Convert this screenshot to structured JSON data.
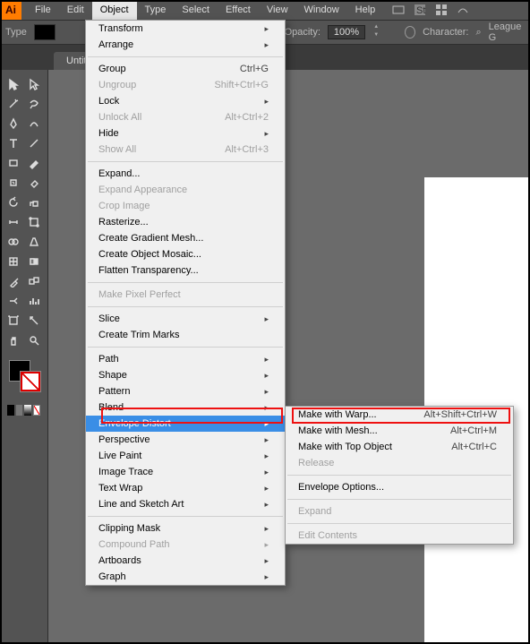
{
  "menubar": {
    "items": [
      "File",
      "Edit",
      "Object",
      "Type",
      "Select",
      "Effect",
      "View",
      "Window",
      "Help"
    ],
    "logo": "Ai"
  },
  "optionsbar": {
    "type_label": "Type",
    "opacity_label": "Opacity:",
    "opacity_value": "100%",
    "character_label": "Character:",
    "font_search": "League G"
  },
  "tab": {
    "title": "Untitl"
  },
  "tools": [
    [
      "selection",
      "direct-selection"
    ],
    [
      "magic-wand",
      "lasso"
    ],
    [
      "pen",
      "curvature"
    ],
    [
      "type",
      "line-segment"
    ],
    [
      "rectangle",
      "paintbrush"
    ],
    [
      "shaper",
      "eraser"
    ],
    [
      "rotate",
      "scale"
    ],
    [
      "width",
      "free-transform"
    ],
    [
      "shape-builder",
      "perspective"
    ],
    [
      "mesh",
      "gradient"
    ],
    [
      "eyedropper",
      "blend"
    ],
    [
      "symbol-sprayer",
      "column-graph"
    ],
    [
      "artboard",
      "slice"
    ],
    [
      "hand",
      "zoom"
    ]
  ],
  "object_menu": [
    {
      "label": "Transform",
      "sub": true
    },
    {
      "label": "Arrange",
      "sub": true
    },
    {
      "sep": true
    },
    {
      "label": "Group",
      "shortcut": "Ctrl+G"
    },
    {
      "label": "Ungroup",
      "shortcut": "Shift+Ctrl+G",
      "disabled": true
    },
    {
      "label": "Lock",
      "sub": true
    },
    {
      "label": "Unlock All",
      "shortcut": "Alt+Ctrl+2",
      "disabled": true
    },
    {
      "label": "Hide",
      "sub": true
    },
    {
      "label": "Show All",
      "shortcut": "Alt+Ctrl+3",
      "disabled": true
    },
    {
      "sep": true
    },
    {
      "label": "Expand..."
    },
    {
      "label": "Expand Appearance",
      "disabled": true
    },
    {
      "label": "Crop Image",
      "disabled": true
    },
    {
      "label": "Rasterize..."
    },
    {
      "label": "Create Gradient Mesh..."
    },
    {
      "label": "Create Object Mosaic..."
    },
    {
      "label": "Flatten Transparency..."
    },
    {
      "sep": true
    },
    {
      "label": "Make Pixel Perfect",
      "disabled": true
    },
    {
      "sep": true
    },
    {
      "label": "Slice",
      "sub": true
    },
    {
      "label": "Create Trim Marks"
    },
    {
      "sep": true
    },
    {
      "label": "Path",
      "sub": true
    },
    {
      "label": "Shape",
      "sub": true
    },
    {
      "label": "Pattern",
      "sub": true
    },
    {
      "label": "Blend",
      "sub": true
    },
    {
      "label": "Envelope Distort",
      "sub": true,
      "highlight": true
    },
    {
      "label": "Perspective",
      "sub": true
    },
    {
      "label": "Live Paint",
      "sub": true
    },
    {
      "label": "Image Trace",
      "sub": true
    },
    {
      "label": "Text Wrap",
      "sub": true
    },
    {
      "label": "Line and Sketch Art",
      "sub": true
    },
    {
      "sep": true
    },
    {
      "label": "Clipping Mask",
      "sub": true
    },
    {
      "label": "Compound Path",
      "sub": true,
      "disabled": true
    },
    {
      "label": "Artboards",
      "sub": true
    },
    {
      "label": "Graph",
      "sub": true
    }
  ],
  "envelope_submenu": [
    {
      "label": "Make with Warp...",
      "shortcut": "Alt+Shift+Ctrl+W"
    },
    {
      "label": "Make with Mesh...",
      "shortcut": "Alt+Ctrl+M"
    },
    {
      "label": "Make with Top Object",
      "shortcut": "Alt+Ctrl+C"
    },
    {
      "label": "Release",
      "disabled": true
    },
    {
      "sep": true
    },
    {
      "label": "Envelope Options..."
    },
    {
      "sep": true
    },
    {
      "label": "Expand",
      "disabled": true
    },
    {
      "sep": true
    },
    {
      "label": "Edit Contents",
      "disabled": true
    }
  ]
}
